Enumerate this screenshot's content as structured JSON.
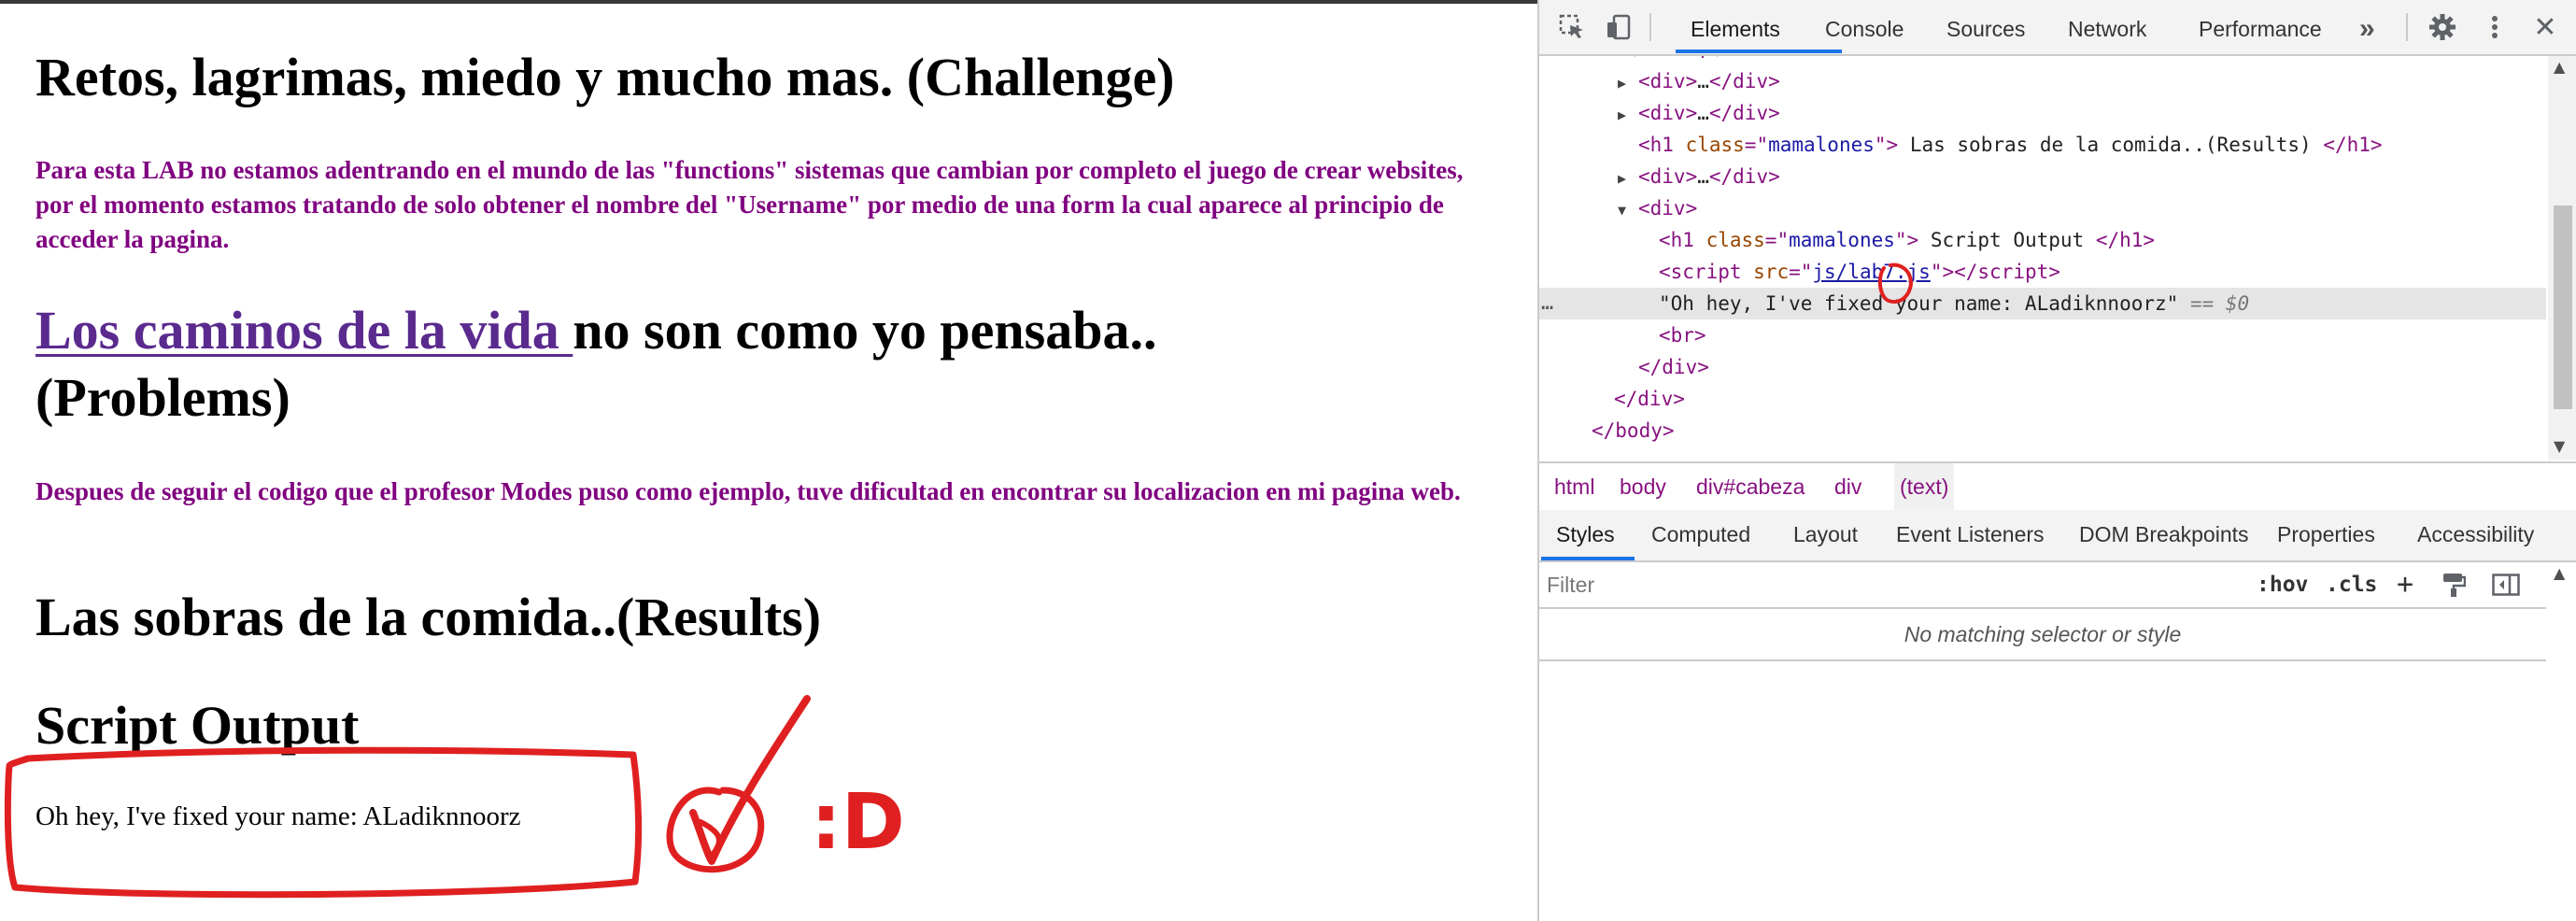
{
  "page": {
    "challenge_heading": "Retos, lagrimas, miedo y mucho mas. (Challenge)",
    "challenge_text": "Para esta LAB no estamos adentrando en el mundo de las \"functions\" sistemas que cambian por completo el juego de crear websites, por el momento estamos tratando de solo obtener el nombre del \"Username\" por medio de una form la cual aparece al principio de acceder la pagina.",
    "problems_link": "Los caminos de la vida ",
    "problems_heading_rest": "no son como yo pensaba..",
    "problems_heading_line2": "(Problems)",
    "problems_text": "Despues de seguir el codigo que el profesor Modes puso como ejemplo, tuve dificultad en encontrar su localizacion en mi pagina web.",
    "results_heading": "Las sobras de la comida..(Results)",
    "output_heading": "Script Output",
    "output_text": "Oh hey, I've fixed your name: ALadiknnoorz",
    "annotation_smiley": ":D"
  },
  "devtools": {
    "tabs": [
      "Elements",
      "Console",
      "Sources",
      "Network",
      "Performance"
    ],
    "overflow": "»",
    "dom": {
      "collapsed_div": "…",
      "h1_results": " Las sobras de la comida..(Results) ",
      "h1_script": " Script Output ",
      "class_value": "mamalones",
      "script_src": "js/lab7.js",
      "text_node": "\"Oh hey, I've fixed your name: ALadiknnoorz\"",
      "eq_marker": "== $0",
      "dots": "…"
    },
    "breadcrumbs": [
      "html",
      "body",
      "div#cabeza",
      "div",
      "(text)"
    ],
    "styles_tabs": [
      "Styles",
      "Computed",
      "Layout",
      "Event Listeners",
      "DOM Breakpoints",
      "Properties",
      "Accessibility"
    ],
    "filter_placeholder": "Filter",
    "hov": ":hov",
    "cls": ".cls",
    "plus": "+",
    "no_match": "No matching selector or style"
  },
  "colors": {
    "purple_text": "#800080",
    "link": "#5a2a8e",
    "annotation_red": "#e02020",
    "devtools_accent": "#1a73e8"
  }
}
